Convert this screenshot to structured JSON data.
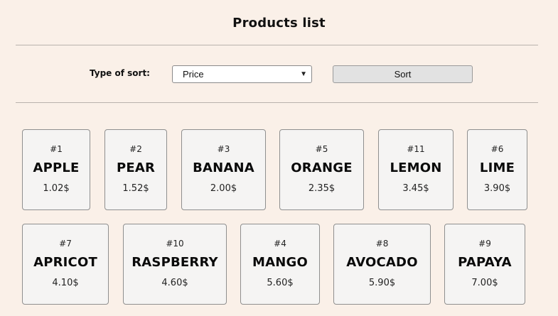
{
  "header": {
    "title": "Products list"
  },
  "sort": {
    "label": "Type of sort:",
    "selected": "Price",
    "button_label": "Sort"
  },
  "products": [
    {
      "num": "#1",
      "name": "APPLE",
      "price": "1.02$"
    },
    {
      "num": "#2",
      "name": "PEAR",
      "price": "1.52$"
    },
    {
      "num": "#3",
      "name": "BANANA",
      "price": "2.00$"
    },
    {
      "num": "#5",
      "name": "ORANGE",
      "price": "2.35$"
    },
    {
      "num": "#11",
      "name": "LEMON",
      "price": "3.45$"
    },
    {
      "num": "#6",
      "name": "LIME",
      "price": "3.90$"
    },
    {
      "num": "#7",
      "name": "APRICOT",
      "price": "4.10$"
    },
    {
      "num": "#10",
      "name": "RASPBERRY",
      "price": "4.60$"
    },
    {
      "num": "#4",
      "name": "MANGO",
      "price": "5.60$"
    },
    {
      "num": "#8",
      "name": "AVOCADO",
      "price": "5.90$"
    },
    {
      "num": "#9",
      "name": "PAPAYA",
      "price": "7.00$"
    }
  ]
}
